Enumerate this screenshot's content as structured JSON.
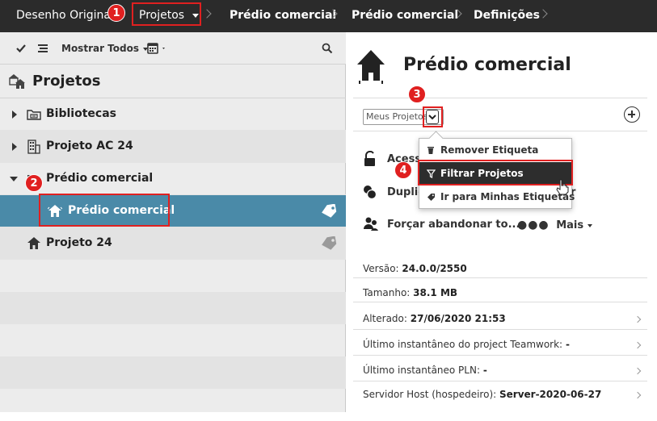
{
  "breadcrumb": {
    "items": [
      "Desenho Original",
      "Projetos",
      "Prédio comercial",
      "Prédio comercial",
      "Definições"
    ]
  },
  "toolbar": {
    "filter_label": "Mostrar Todos"
  },
  "tree": {
    "title": "Projetos",
    "rows": [
      {
        "label": "Bibliotecas"
      },
      {
        "label": "Projeto AC 24"
      },
      {
        "label": "Prédio comercial"
      },
      {
        "label": "Prédio comercial"
      },
      {
        "label": "Projeto 24"
      }
    ]
  },
  "detail": {
    "title": "Prédio comercial",
    "select_value": "Meus Projetos",
    "actions": {
      "access": "Acesso",
      "duplicate": "Duplicar",
      "duplicate_tail": "r",
      "force": "Forçar abandonar to...",
      "more": "Mais"
    },
    "info": [
      {
        "label": "Versão:",
        "value": "24.0.0/2550"
      },
      {
        "label": "Tamanho:",
        "value": "38.1 MB"
      },
      {
        "label": "Alterado:",
        "value": "27/06/2020 21:53"
      },
      {
        "label": "Último instantâneo do project Teamwork:",
        "value": "-"
      },
      {
        "label": "Último instantâneo PLN:",
        "value": "-"
      },
      {
        "label": "Servidor Host (hospedeiro):",
        "value": "Server-2020-06-27"
      }
    ]
  },
  "menu": {
    "items": [
      {
        "label": "Remover Etiqueta",
        "icon": "trash-icon"
      },
      {
        "label": "Filtrar Projetos",
        "icon": "filter-icon"
      },
      {
        "label": "Ir para Minhas Etiquetas",
        "icon": "tag-icon"
      }
    ]
  },
  "callouts": [
    "1",
    "2",
    "3",
    "4"
  ],
  "colors": {
    "topbar": "#2b2b2b",
    "selection": "#4a8aa8",
    "callout": "#e02020",
    "menu_highlight": "#2d2d2d"
  }
}
